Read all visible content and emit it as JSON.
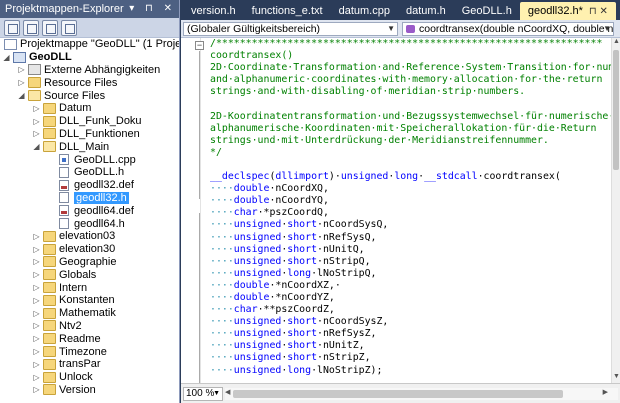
{
  "explorer": {
    "title": "Projektmappen-Explorer",
    "title_buttons": "▾ ⊓ ✕",
    "toolbar_buttons": [
      "properties-icon",
      "show-all-files-icon",
      "refresh-icon",
      "view-code-icon"
    ],
    "tree": [
      {
        "level": 0,
        "label": "Projektmappe \"GeoDLL\" (1 Projekt)",
        "icon": "solution",
        "expander": ""
      },
      {
        "level": 0,
        "label": "GeoDLL",
        "icon": "project",
        "expander": "◢",
        "bold": true
      },
      {
        "level": 1,
        "label": "Externe Abhängigkeiten",
        "icon": "refs",
        "expander": "▷"
      },
      {
        "level": 1,
        "label": "Resource Files",
        "icon": "folder",
        "expander": "▷"
      },
      {
        "level": 1,
        "label": "Source Files",
        "icon": "folder-open",
        "expander": "◢"
      },
      {
        "level": 2,
        "label": "Datum",
        "icon": "folder",
        "expander": "▷"
      },
      {
        "level": 2,
        "label": "DLL_Funk_Doku",
        "icon": "folder",
        "expander": "▷"
      },
      {
        "level": 2,
        "label": "DLL_Funktionen",
        "icon": "folder",
        "expander": "▷"
      },
      {
        "level": 2,
        "label": "DLL_Main",
        "icon": "folder-open",
        "expander": "◢"
      },
      {
        "level": 3,
        "label": "GeoDLL.cpp",
        "icon": "file-cpp",
        "expander": ""
      },
      {
        "level": 3,
        "label": "GeoDLL.h",
        "icon": "file",
        "expander": ""
      },
      {
        "level": 3,
        "label": "geodll32.def",
        "icon": "file-def",
        "expander": ""
      },
      {
        "level": 3,
        "label": "geodll32.h",
        "icon": "file",
        "expander": "",
        "selected": true
      },
      {
        "level": 3,
        "label": "geodll64.def",
        "icon": "file-def",
        "expander": ""
      },
      {
        "level": 3,
        "label": "geodll64.h",
        "icon": "file",
        "expander": ""
      },
      {
        "level": 2,
        "label": "elevation03",
        "icon": "folder",
        "expander": "▷"
      },
      {
        "level": 2,
        "label": "elevation30",
        "icon": "folder",
        "expander": "▷"
      },
      {
        "level": 2,
        "label": "Geographie",
        "icon": "folder",
        "expander": "▷"
      },
      {
        "level": 2,
        "label": "Globals",
        "icon": "folder",
        "expander": "▷"
      },
      {
        "level": 2,
        "label": "Intern",
        "icon": "folder",
        "expander": "▷"
      },
      {
        "level": 2,
        "label": "Konstanten",
        "icon": "folder",
        "expander": "▷"
      },
      {
        "level": 2,
        "label": "Mathematik",
        "icon": "folder",
        "expander": "▷"
      },
      {
        "level": 2,
        "label": "Ntv2",
        "icon": "folder",
        "expander": "▷"
      },
      {
        "level": 2,
        "label": "Readme",
        "icon": "folder",
        "expander": "▷"
      },
      {
        "level": 2,
        "label": "Timezone",
        "icon": "folder",
        "expander": "▷"
      },
      {
        "level": 2,
        "label": "transPar",
        "icon": "folder",
        "expander": "▷"
      },
      {
        "level": 2,
        "label": "Unlock",
        "icon": "folder",
        "expander": "▷"
      },
      {
        "level": 2,
        "label": "Version",
        "icon": "folder",
        "expander": "▷"
      }
    ]
  },
  "editor": {
    "tabs": [
      {
        "label": "version.h",
        "active": false
      },
      {
        "label": "functions_e.txt",
        "active": false
      },
      {
        "label": "datum.cpp",
        "active": false
      },
      {
        "label": "datum.h",
        "active": false
      },
      {
        "label": "GeoDLL.h",
        "active": false
      },
      {
        "label": "geodll32.h*",
        "active": true
      }
    ],
    "tab_pin": "⊓ ✕",
    "tab_overflow": "▾",
    "scope_dropdown": "(Globaler Gültigkeitsbereich)",
    "member_dropdown": "coordtransex(double nCoordXQ, double nCoordY",
    "zoom": "100 %",
    "code_lines": [
      [
        {
          "c": "c",
          "t": "/*****************************************************************"
        }
      ],
      [
        {
          "c": "c",
          "t": "coordtransex()"
        }
      ],
      [
        {
          "c": "c",
          "t": "2D·Coordinate·Transformation·and·Reference·System·Transition·for·numeric"
        }
      ],
      [
        {
          "c": "c",
          "t": "and·alphanumeric·coordinates·with·memory·allocation·for·the·return"
        }
      ],
      [
        {
          "c": "c",
          "t": "strings·and·with·disabling·of·meridian·strip·numbers."
        }
      ],
      [
        {
          "c": "c",
          "t": ""
        }
      ],
      [
        {
          "c": "c",
          "t": "2D-Koordinatentransformation·und·Bezugssystemwechsel·für·numerische·und"
        }
      ],
      [
        {
          "c": "c",
          "t": "alphanumerische·Koordinaten·mit·Speicherallokation·für·die·Return"
        }
      ],
      [
        {
          "c": "c",
          "t": "strings·und·mit·Unterdrückung·der·Meridianstreifennummer."
        }
      ],
      [
        {
          "c": "c",
          "t": "*/"
        }
      ],
      [
        {
          "c": "t",
          "t": ""
        }
      ],
      [
        {
          "c": "k",
          "t": "__declspec"
        },
        {
          "c": "t",
          "t": "("
        },
        {
          "c": "k",
          "t": "dllimport"
        },
        {
          "c": "t",
          "t": ")·"
        },
        {
          "c": "k",
          "t": "unsigned"
        },
        {
          "c": "t",
          "t": "·"
        },
        {
          "c": "k",
          "t": "long"
        },
        {
          "c": "t",
          "t": "·"
        },
        {
          "c": "k",
          "t": "__stdcall"
        },
        {
          "c": "t",
          "t": "·coordtransex("
        }
      ],
      [
        {
          "c": "ws",
          "t": "····"
        },
        {
          "c": "k",
          "t": "double"
        },
        {
          "c": "t",
          "t": "·nCoordXQ,"
        }
      ],
      [
        {
          "c": "ws",
          "t": "····"
        },
        {
          "c": "k",
          "t": "double"
        },
        {
          "c": "t",
          "t": "·nCoordYQ,"
        }
      ],
      [
        {
          "c": "ws",
          "t": "····"
        },
        {
          "c": "k",
          "t": "char"
        },
        {
          "c": "t",
          "t": "·*pszCoordQ,"
        }
      ],
      [
        {
          "c": "ws",
          "t": "····"
        },
        {
          "c": "k",
          "t": "unsigned"
        },
        {
          "c": "t",
          "t": "·"
        },
        {
          "c": "k",
          "t": "short"
        },
        {
          "c": "t",
          "t": "·nCoordSysQ,"
        }
      ],
      [
        {
          "c": "ws",
          "t": "····"
        },
        {
          "c": "k",
          "t": "unsigned"
        },
        {
          "c": "t",
          "t": "·"
        },
        {
          "c": "k",
          "t": "short"
        },
        {
          "c": "t",
          "t": "·nRefSysQ,"
        }
      ],
      [
        {
          "c": "ws",
          "t": "····"
        },
        {
          "c": "k",
          "t": "unsigned"
        },
        {
          "c": "t",
          "t": "·"
        },
        {
          "c": "k",
          "t": "short"
        },
        {
          "c": "t",
          "t": "·nUnitQ,"
        }
      ],
      [
        {
          "c": "ws",
          "t": "····"
        },
        {
          "c": "k",
          "t": "unsigned"
        },
        {
          "c": "t",
          "t": "·"
        },
        {
          "c": "k",
          "t": "short"
        },
        {
          "c": "t",
          "t": "·nStripQ,"
        }
      ],
      [
        {
          "c": "ws",
          "t": "····"
        },
        {
          "c": "k",
          "t": "unsigned"
        },
        {
          "c": "t",
          "t": "·"
        },
        {
          "c": "k",
          "t": "long"
        },
        {
          "c": "t",
          "t": "·lNoStripQ,"
        }
      ],
      [
        {
          "c": "ws",
          "t": "····"
        },
        {
          "c": "k",
          "t": "double"
        },
        {
          "c": "t",
          "t": "·*nCoordXZ,·"
        }
      ],
      [
        {
          "c": "ws",
          "t": "····"
        },
        {
          "c": "k",
          "t": "double"
        },
        {
          "c": "t",
          "t": "·*nCoordYZ,"
        }
      ],
      [
        {
          "c": "ws",
          "t": "····"
        },
        {
          "c": "k",
          "t": "char"
        },
        {
          "c": "t",
          "t": "·**pszCoordZ,"
        }
      ],
      [
        {
          "c": "ws",
          "t": "····"
        },
        {
          "c": "k",
          "t": "unsigned"
        },
        {
          "c": "t",
          "t": "·"
        },
        {
          "c": "k",
          "t": "short"
        },
        {
          "c": "t",
          "t": "·nCoordSysZ,"
        }
      ],
      [
        {
          "c": "ws",
          "t": "····"
        },
        {
          "c": "k",
          "t": "unsigned"
        },
        {
          "c": "t",
          "t": "·"
        },
        {
          "c": "k",
          "t": "short"
        },
        {
          "c": "t",
          "t": "·nRefSysZ,"
        }
      ],
      [
        {
          "c": "ws",
          "t": "····"
        },
        {
          "c": "k",
          "t": "unsigned"
        },
        {
          "c": "t",
          "t": "·"
        },
        {
          "c": "k",
          "t": "short"
        },
        {
          "c": "t",
          "t": "·nUnitZ,"
        }
      ],
      [
        {
          "c": "ws",
          "t": "····"
        },
        {
          "c": "k",
          "t": "unsigned"
        },
        {
          "c": "t",
          "t": "·"
        },
        {
          "c": "k",
          "t": "short"
        },
        {
          "c": "t",
          "t": "·nStripZ,"
        }
      ],
      [
        {
          "c": "ws",
          "t": "····"
        },
        {
          "c": "k",
          "t": "unsigned"
        },
        {
          "c": "t",
          "t": "·"
        },
        {
          "c": "k",
          "t": "long"
        },
        {
          "c": "t",
          "t": "·lNoStripZ);"
        }
      ],
      [
        {
          "c": "t",
          "t": ""
        }
      ],
      [
        {
          "c": "c",
          "t": "/*****************************************************************"
        }
      ]
    ]
  },
  "colors": {
    "chrome": "#2b3c59",
    "active_tab": "#fff1b0",
    "comment": "#008000",
    "keyword": "#0000ff",
    "selection": "#3399ff"
  }
}
